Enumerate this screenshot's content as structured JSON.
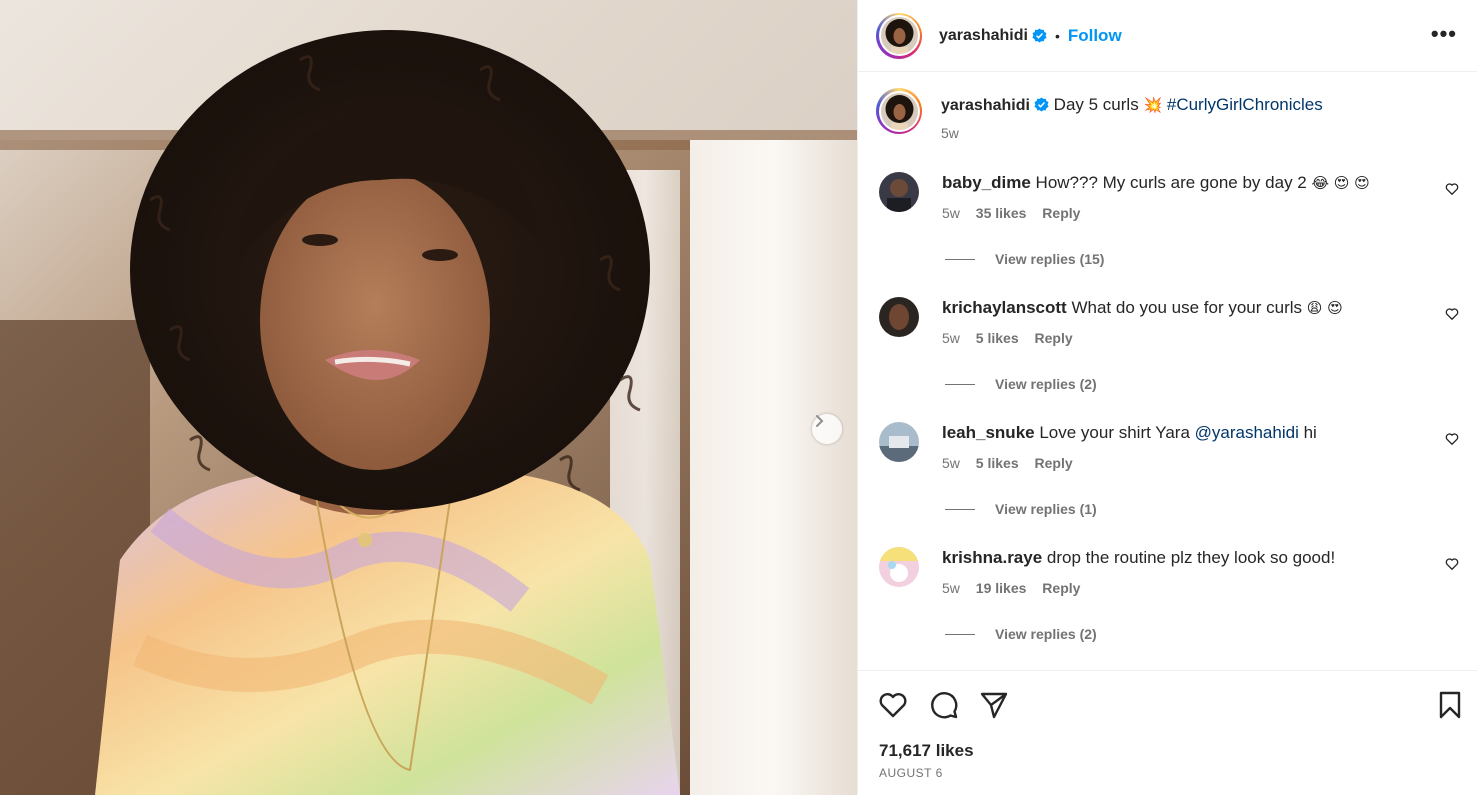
{
  "post": {
    "author": "yarashahidi",
    "follow_label": "Follow",
    "dot": "•",
    "more_label": "•••",
    "caption_text": "Day 5 curls",
    "caption_emoji": "💥",
    "caption_hashtag": "#CurlyGirlChronicles",
    "caption_time": "5w"
  },
  "comments": [
    {
      "user": "baby_dime",
      "text": "How??? My curls are gone by day 2",
      "emoji": "😂 😍 😍",
      "time": "5w",
      "likes": "35 likes",
      "reply": "Reply",
      "view_replies": "View replies (15)"
    },
    {
      "user": "krichaylanscott",
      "text": "What do you use for your curls",
      "emoji": "😩 😍",
      "time": "5w",
      "likes": "5 likes",
      "reply": "Reply",
      "view_replies": "View replies (2)"
    },
    {
      "user": "leah_snuke",
      "text": "Love your shirt Yara",
      "mention": "@yarashahidi",
      "text_after": "hi",
      "time": "5w",
      "likes": "5 likes",
      "reply": "Reply",
      "view_replies": "View replies (1)"
    },
    {
      "user": "krishna.raye",
      "text": "drop the routine plz they look so good!",
      "time": "5w",
      "likes": "19 likes",
      "reply": "Reply",
      "view_replies": "View replies (2)"
    }
  ],
  "footer": {
    "likes": "71,617 likes",
    "date": "AUGUST 6"
  },
  "icons": [
    "chevron-right-icon",
    "verified-badge-icon",
    "heart-icon",
    "comment-icon",
    "share-icon",
    "bookmark-icon",
    "more-icon"
  ],
  "colors": {
    "accent": "#0095f6",
    "hashtag": "#00376b",
    "muted": "#737373",
    "verified": "#0095f6"
  }
}
